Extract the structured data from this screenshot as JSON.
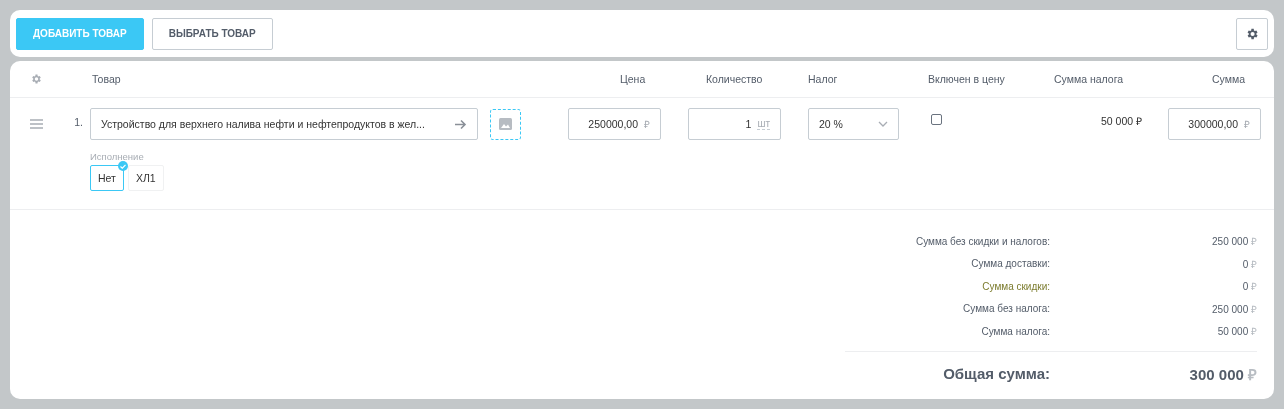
{
  "toolbar": {
    "buttons": [
      {
        "label": "ДОБАВИТЬ ТОВАР",
        "kind": "primary"
      },
      {
        "label": "ВЫБРАТЬ ТОВАР",
        "kind": "secondary"
      }
    ]
  },
  "table": {
    "columns": [
      "Товар",
      "Цена",
      "Количество",
      "Налог",
      "Включен в цену",
      "Сумма налога",
      "Сумма"
    ],
    "rows": [
      {
        "number": "1.",
        "product": "Устройство для верхнего налива нефти и нефтепродуктов в жел...",
        "price": "250000,00",
        "price_currency": "₽",
        "quantity": "1",
        "unit": "шт",
        "tax": "20 %",
        "tax_included": false,
        "tax_sum": "50 000 ₽",
        "sum": "300000,00",
        "sum_currency": "₽",
        "variant_label": "Исполнение",
        "variants": [
          {
            "label": "Нет",
            "selected": true
          },
          {
            "label": "ХЛ1",
            "selected": false
          }
        ]
      }
    ]
  },
  "summary": {
    "rows": [
      {
        "label": "Сумма без скидки и налогов:",
        "value": "250 000",
        "currency": "₽",
        "kind": "plain"
      },
      {
        "label": "Сумма доставки:",
        "value": "0",
        "currency": "₽",
        "kind": "plain"
      },
      {
        "label": "Сумма скидки:",
        "value": "0",
        "currency": "₽",
        "kind": "discount"
      },
      {
        "label": "Сумма без налога:",
        "value": "250 000",
        "currency": "₽",
        "kind": "plain"
      },
      {
        "label": "Сумма налога:",
        "value": "50 000",
        "currency": "₽",
        "kind": "plain"
      }
    ],
    "total": {
      "label": "Общая сумма:",
      "value": "300 000",
      "currency": "₽"
    }
  }
}
